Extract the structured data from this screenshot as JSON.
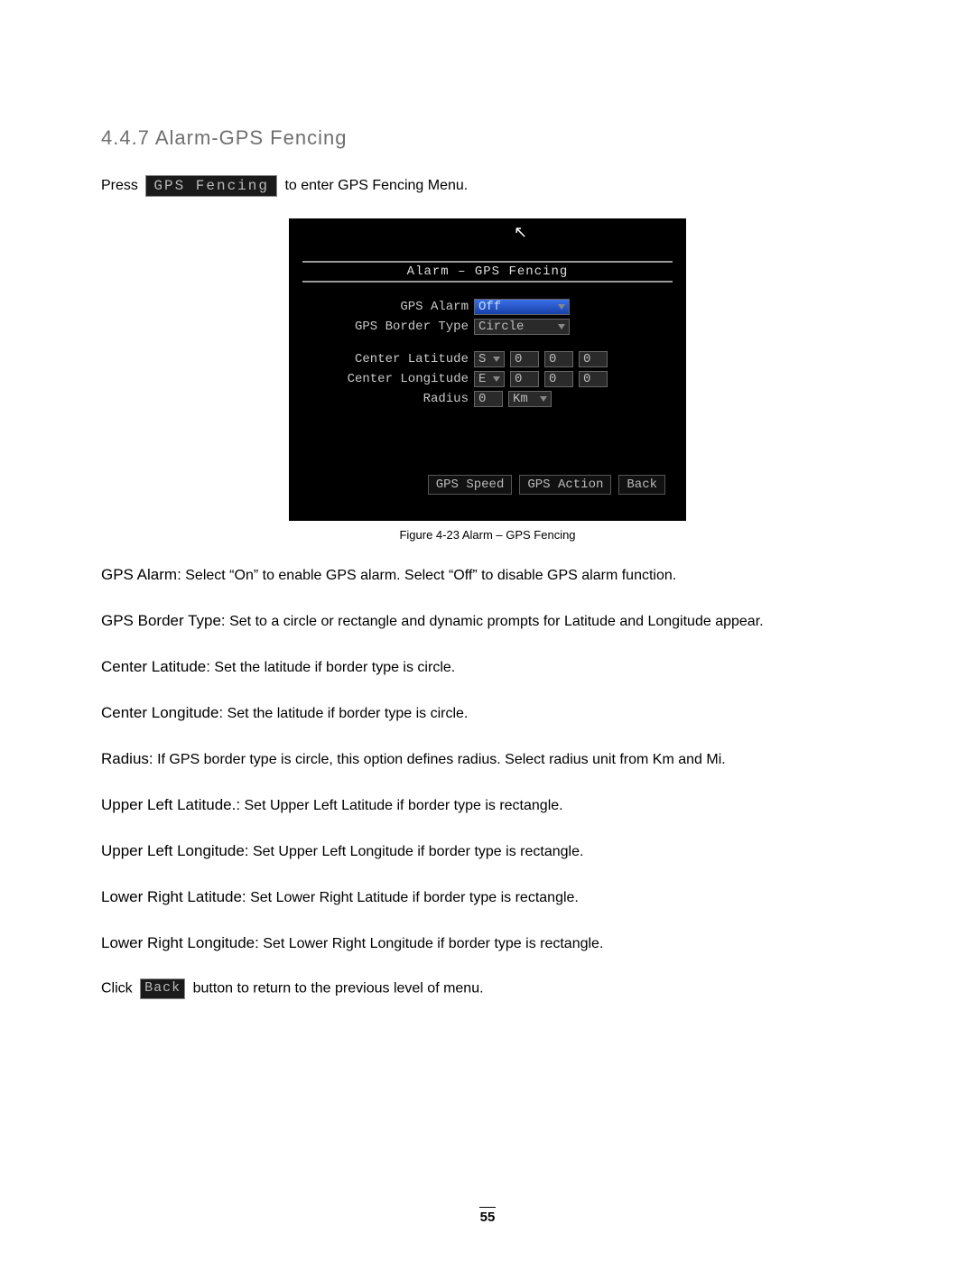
{
  "heading": "4.4.7 Alarm-GPS Fencing",
  "press_line": {
    "prefix": "Press",
    "chip": "GPS Fencing",
    "suffix": " to enter GPS Fencing Menu."
  },
  "osd": {
    "title": "Alarm – GPS Fencing",
    "rows": {
      "gps_alarm": {
        "label": "GPS Alarm",
        "value": "Off"
      },
      "border_type": {
        "label": "GPS Border Type",
        "value": "Circle"
      },
      "lat": {
        "label": "Center Latitude",
        "hemi": "S",
        "v1": "0",
        "v2": "0",
        "v3": "0"
      },
      "lon": {
        "label": "Center Longitude",
        "hemi": "E",
        "v1": "0",
        "v2": "0",
        "v3": "0"
      },
      "radius": {
        "label": "Radius",
        "value": "0",
        "unit": "Km"
      }
    },
    "buttons": {
      "speed": "GPS Speed",
      "action": "GPS Action",
      "back": "Back"
    }
  },
  "caption": "Figure 4-23 Alarm – GPS Fencing",
  "defs": {
    "gps_alarm": {
      "term": "GPS Alarm:",
      "text": " Select “On” to enable GPS alarm. Select “Off” to disable GPS alarm function."
    },
    "border": {
      "term": "GPS Border Type:",
      "text": " Set to a circle or rectangle and dynamic prompts for Latitude and Longitude appear."
    },
    "clat": {
      "term": "Center Latitude:",
      "text": " Set the latitude if border type is circle."
    },
    "clon": {
      "term": "Center Longitude:",
      "text": " Set the latitude if border type is circle."
    },
    "radius": {
      "term": "Radius:",
      "text": " If GPS border type is circle, this option defines radius. Select radius unit from Km and Mi."
    },
    "ullat": {
      "term": "Upper Left Latitude.:",
      "text": " Set Upper Left Latitude if border type is rectangle."
    },
    "ullon": {
      "term": "Upper Left Longitude:",
      "text": " Set Upper Left Longitude if border type is rectangle."
    },
    "lrlat": {
      "term": "Lower Right Latitude:",
      "text": " Set Lower Right Latitude if border type is rectangle."
    },
    "lrlon": {
      "term": "Lower Right Longitude:",
      "text": " Set Lower Right Longitude if border type is rectangle."
    }
  },
  "click_line": {
    "prefix": "Click ",
    "chip": "Back",
    "suffix": " button to return to the previous level of menu."
  },
  "pagenum": "55"
}
